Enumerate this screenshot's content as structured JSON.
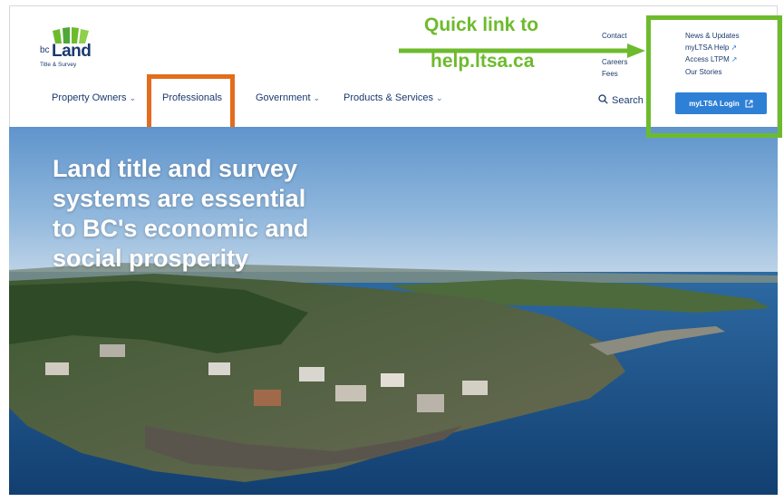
{
  "logo": {
    "prefix": "bc",
    "name": "Land",
    "tagline": "Title & Survey"
  },
  "nav": [
    {
      "label": "Property Owners",
      "has_dropdown": true
    },
    {
      "label": "Professionals",
      "has_dropdown": false
    },
    {
      "label": "Government",
      "has_dropdown": true
    },
    {
      "label": "Products & Services",
      "has_dropdown": true
    }
  ],
  "utility_links": {
    "col1": [
      "Contact",
      "Careers",
      "Fees"
    ],
    "col2": [
      {
        "label": "News & Updates",
        "external": false
      },
      {
        "label": "myLTSA Help",
        "external": true
      },
      {
        "label": "Access LTPM",
        "external": true
      },
      {
        "label": "Our Stories",
        "external": false
      }
    ]
  },
  "search": {
    "label": "Search",
    "icon": "search-icon"
  },
  "login": {
    "label": "myLTSA Login",
    "icon": "external-link-icon"
  },
  "callout": {
    "line1": "Quick link to",
    "line2": "help.ltsa.ca"
  },
  "hero": {
    "lines": [
      "Land title and survey",
      "systems are essential",
      "to BC's economic and",
      "social prosperity"
    ]
  },
  "colors": {
    "navy": "#1a3a6e",
    "button_blue": "#2e7fd6",
    "highlight_orange": "#e36c1d",
    "highlight_green": "#6dbb2d"
  }
}
